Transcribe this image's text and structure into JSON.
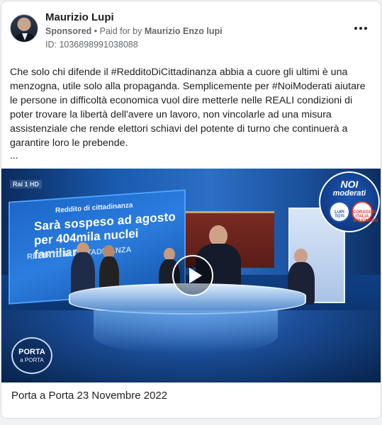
{
  "ad": {
    "page_name": "Maurizio Lupi",
    "sponsored_label": "Sponsored",
    "separator": " • ",
    "paid_for_prefix": "Paid for by ",
    "payer_name": "Maurizio Enzo lupi",
    "ad_id": "ID: 1036898991038088",
    "body_text": "Che solo chi difende il #RedditoDiCittadinanza abbia a cuore gli ultimi è una menzogna, utile solo alla propaganda. Semplicemente per #NoiModerati aiutare le persone in difficoltà economica vuol dire metterle nelle REALI condizioni di poter trovare la libertà dell'avere un lavoro, non vincolarle ad una misura assistenziale che rende elettori schiavi del potente di turno che continuerà a garantire loro le prebende.",
    "truncation": "...",
    "caption": "Porta a Porta 23 Novembre 2022"
  },
  "video": {
    "screen_kicker": "Reddito di cittadinanza",
    "screen_head1": "Sarà sospeso ad agosto",
    "screen_head2": "per 404mila nuclei familiari",
    "screen_side": "REDDITO DI CITTADINANZA",
    "channel_logo": "Rai 1 HD",
    "badge_line1": "NOI",
    "badge_line2": "moderati",
    "badge_left": "LUPI TOTI",
    "badge_right": "CORAGGIO ITALIA BRUGNARO",
    "show_logo_line1": "PORTA",
    "show_logo_line2": "a PORTA"
  },
  "colors": {
    "text_primary": "#1c1e21",
    "text_secondary": "#65676b",
    "card_bg": "#ffffff",
    "page_bg": "#f0f2f5"
  },
  "icons": {
    "more": "more-horizontal-icon",
    "play": "play-icon"
  }
}
